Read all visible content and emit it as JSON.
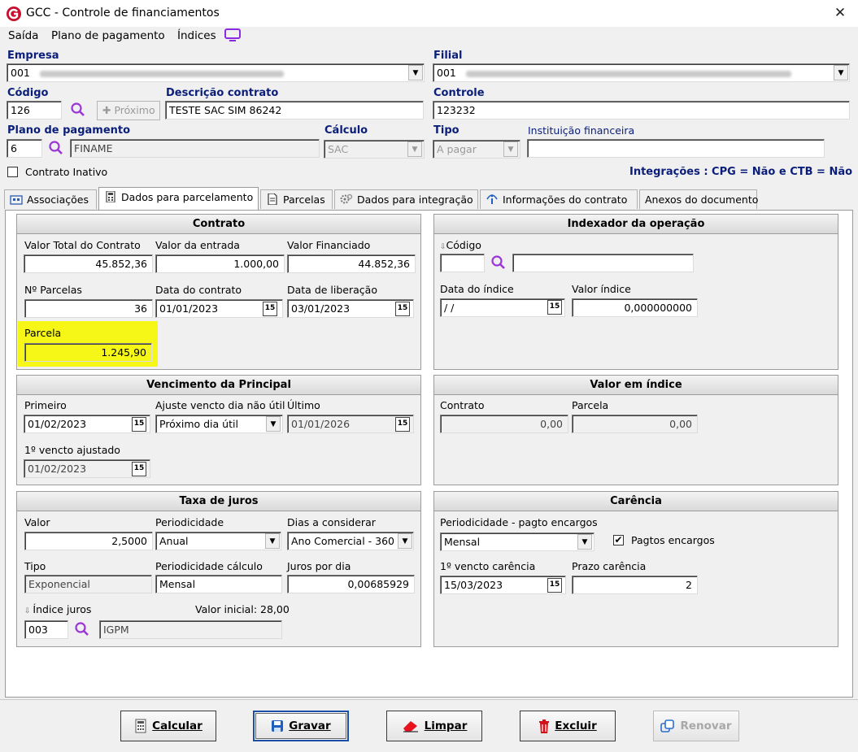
{
  "window": {
    "title": "GCC - Controle de financiamentos",
    "close_glyph": "✕"
  },
  "menu": [
    "Saída",
    "Plano de pagamento",
    "Índices"
  ],
  "header": {
    "empresa": {
      "label": "Empresa",
      "value": "001"
    },
    "filial": {
      "label": "Filial",
      "value": "001"
    },
    "codigo": {
      "label": "Código",
      "value": "126"
    },
    "proximo_label": "Próximo",
    "descricao": {
      "label": "Descrição contrato",
      "value": "TESTE SAC SIM 86242"
    },
    "controle": {
      "label": "Controle",
      "value": "123232"
    },
    "plano": {
      "label": "Plano de pagamento",
      "code": "6",
      "name": "FINAME"
    },
    "calculo": {
      "label": "Cálculo",
      "value": "SAC"
    },
    "tipo": {
      "label": "Tipo",
      "value": "A pagar"
    },
    "instituicao": {
      "label": "Instituição financeira",
      "value": ""
    },
    "inativo": {
      "label": "Contrato Inativo",
      "checked": false
    },
    "integracoes": "Integrações : CPG = Não e CTB = Não"
  },
  "tabs": [
    {
      "label": "Associações",
      "icon": "building-icon",
      "active": false
    },
    {
      "label": "Dados para parcelamento",
      "icon": "calculator-icon",
      "active": true
    },
    {
      "label": "Parcelas",
      "icon": "document-icon",
      "active": false
    },
    {
      "label": "Dados para integração",
      "icon": "gears-icon",
      "active": false
    },
    {
      "label": "Informações do contrato",
      "icon": "info-icon",
      "active": false
    },
    {
      "label": "Anexos do documento",
      "icon": "",
      "active": false
    }
  ],
  "contrato": {
    "title": "Contrato",
    "valor_total": {
      "label": "Valor Total do Contrato",
      "value": "45.852,36"
    },
    "valor_entrada": {
      "label": "Valor da entrada",
      "value": "1.000,00"
    },
    "valor_financiado": {
      "label": "Valor Financiado",
      "value": "44.852,36"
    },
    "n_parcelas": {
      "label": "Nº Parcelas",
      "value": "36"
    },
    "data_contrato": {
      "label": "Data do contrato",
      "value": "01/01/2023"
    },
    "data_liberacao": {
      "label": "Data de liberação",
      "value": "03/01/2023"
    },
    "parcela": {
      "label": "Parcela",
      "value": "1.245,90"
    }
  },
  "indexador": {
    "title": "Indexador da operação",
    "codigo": {
      "label": "Código",
      "value": "",
      "name": ""
    },
    "data_indice": {
      "label": "Data do índice",
      "value": " / /"
    },
    "valor_indice": {
      "label": "Valor índice",
      "value": "0,000000000"
    }
  },
  "vencimento": {
    "title": "Vencimento da Principal",
    "primeiro": {
      "label": "Primeiro",
      "value": "01/02/2023"
    },
    "ajuste": {
      "label": "Ajuste vencto dia não útil",
      "value": "Próximo dia útil"
    },
    "ultimo": {
      "label": "Último",
      "value": "01/01/2026"
    },
    "ajustado": {
      "label": "1º vencto ajustado",
      "value": "01/02/2023"
    }
  },
  "valor_indice": {
    "title": "Valor em índice",
    "contrato": {
      "label": "Contrato",
      "value": "0,00"
    },
    "parcela": {
      "label": "Parcela",
      "value": "0,00"
    }
  },
  "taxa": {
    "title": "Taxa de juros",
    "valor": {
      "label": "Valor",
      "value": "2,5000"
    },
    "periodicidade": {
      "label": "Periodicidade",
      "value": "Anual"
    },
    "dias": {
      "label": "Dias a considerar",
      "value": "Ano Comercial - 360"
    },
    "tipo": {
      "label": "Tipo",
      "value": "Exponencial"
    },
    "periodicidade_calculo": {
      "label": "Periodicidade cálculo",
      "value": "Mensal"
    },
    "juros_dia": {
      "label": "Juros por dia",
      "value": "0,00685929"
    },
    "indice": {
      "label": "Índice juros",
      "code": "003",
      "name": "IGPM"
    },
    "valor_inicial": "Valor inicial: 28,00"
  },
  "carencia": {
    "title": "Carência",
    "periodicidade": {
      "label": "Periodicidade - pagto encargos",
      "value": "Mensal"
    },
    "pagtos": {
      "label": "Pagtos encargos",
      "checked": true
    },
    "vencto": {
      "label": "1º vencto carência",
      "value": "15/03/2023"
    },
    "prazo": {
      "label": "Prazo carência",
      "value": "2"
    }
  },
  "buttons": {
    "calcular": "Calcular",
    "gravar": "Gravar",
    "limpar": "Limpar",
    "excluir": "Excluir",
    "renovar": "Renovar"
  },
  "colors": {
    "label_blue": "#0a1e7a",
    "highlight": "#f6f716",
    "search": "#9b35d8",
    "red": "#d0121b"
  }
}
